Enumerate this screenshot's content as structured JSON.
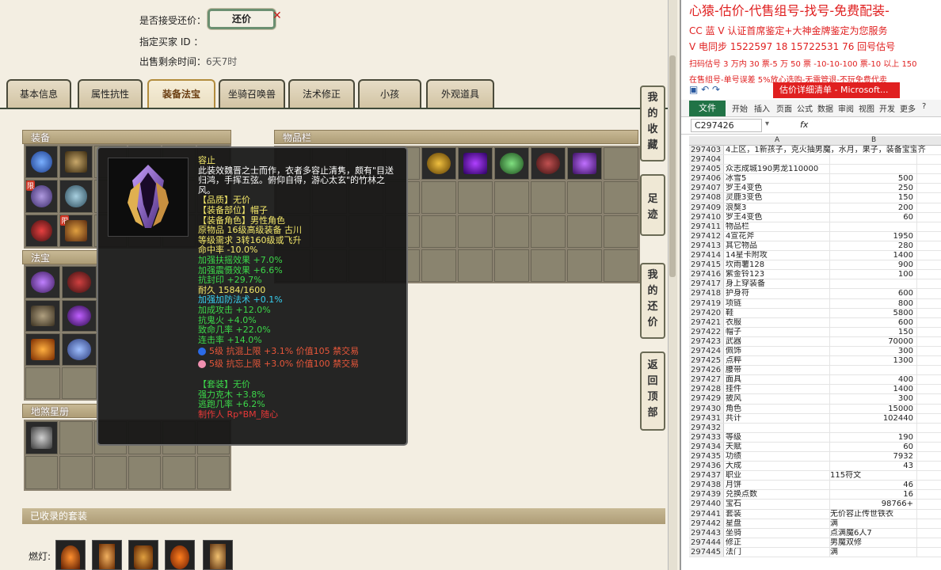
{
  "header": {
    "accept_offer_label": "是否接受还价：",
    "offer_button": "还价",
    "buyer_label": "指定买家 ID ：",
    "time_label": "出售剩余时间：",
    "time_value": "6天7时"
  },
  "tabs": [
    "基本信息",
    "属性抗性",
    "装备法宝",
    "坐骑召唤兽",
    "法术修正",
    "小孩",
    "外观道具"
  ],
  "panels": {
    "equip": "装备",
    "inventory": "物品栏",
    "treasure": "法宝",
    "star_book": "地煞星册",
    "collected_sets": "已收录的套装",
    "lamp_label": "燃灯:"
  },
  "limit_badge": "限",
  "side_nav": [
    [
      "我",
      "的",
      "收",
      "藏"
    ],
    [
      "足",
      "迹"
    ],
    [
      "我",
      "的",
      "还",
      "价"
    ],
    [
      "返",
      "回",
      "顶",
      "部"
    ]
  ],
  "tooltip": {
    "lines": [
      {
        "t": "容止",
        "c": "y"
      },
      {
        "t": "此装效魏晋之士而作，衣者多容止清隽，颇有\"目送",
        "c": "w"
      },
      {
        "t": "归鸿，手挥五弦。俯仰自得，游心太玄\"的竹林之",
        "c": "w"
      },
      {
        "t": "风。",
        "c": "w"
      },
      {
        "t": "【品质】无价",
        "c": "y"
      },
      {
        "t": "【装备部位】帽子",
        "c": "y"
      },
      {
        "t": "【装备角色】男性角色",
        "c": "y"
      },
      {
        "t": "原物品 16级高级装备 古川",
        "c": "y"
      },
      {
        "t": "等级需求 3转160级或飞升",
        "c": "y"
      },
      {
        "t": "命中率 -10.0%",
        "c": "y"
      },
      {
        "t": "加强扶摇效果 +7.0%",
        "c": "g"
      },
      {
        "t": "加强震慑效果 +6.6%",
        "c": "g"
      },
      {
        "t": "抗封印 +29.7%",
        "c": "g"
      },
      {
        "t": "耐久 1584/1600",
        "c": "y"
      },
      {
        "t": "加强加防法术 +0.1%",
        "c": "c"
      },
      {
        "t": "加成攻击 +12.0%",
        "c": "g"
      },
      {
        "t": "抗鬼火 +4.0%",
        "c": "g"
      },
      {
        "t": "致命几率 +22.0%",
        "c": "g"
      },
      {
        "t": "连击率 +14.0%",
        "c": "g"
      }
    ],
    "gems": [
      {
        "t": "5级 抗混上限 +3.1% 价值105 禁交易",
        "color": "#2b6be8"
      },
      {
        "t": "5级 抗忘上限 +3.0% 价值100 禁交易",
        "color": "#f090b0"
      }
    ],
    "set_lines": [
      {
        "t": "【套装】无价",
        "c": "g",
        "tail": "无价",
        "tail_c": "c"
      },
      {
        "t": "强力克木 +3.8%",
        "c": "g"
      },
      {
        "t": "逃跑几率 +6.2%",
        "c": "g"
      },
      {
        "t": "制作人 Rp*BM_随心",
        "c": "r"
      }
    ]
  },
  "ads": [
    {
      "t": "心猿-估价-代售组号-找号-免费配装-",
      "size": 16
    },
    {
      "t": "CC 蓝 V 认证首席鉴定+大神金牌鉴定为您服务",
      "size": 12
    },
    {
      "t": "V 电同步 1522597 18 15722531 76 回号估号",
      "size": 12
    },
    {
      "t": "扫码估号 3 万内 30 票-5 万 50 票 -10-10-100 票-10 以上 150",
      "size": 10
    },
    {
      "t": "在售组号-单号误差 5%放心选购-无需管退-不玩免费代卖",
      "size": 10
    }
  ],
  "excel": {
    "window_title": "估价详细清单 - Microsoft...",
    "file_tab": "文件",
    "menus": [
      "开始",
      "插入",
      "页面",
      "公式",
      "数据",
      "审阅",
      "视图",
      "开发",
      "更多"
    ],
    "name_box": "C297426",
    "fx": "fx",
    "columns": [
      "A",
      "B"
    ],
    "rows": [
      [
        "297403",
        "4上区，1新孩子，克火抽男魔，水月，果子，装备宝宝齐",
        ""
      ],
      [
        "297404",
        "",
        ""
      ],
      [
        "297405",
        "众志成城190男龙110000",
        ""
      ],
      [
        "297406",
        "冰雪5",
        "500"
      ],
      [
        "297407",
        "罗王4变色",
        "250"
      ],
      [
        "297408",
        "灵鹿3变色",
        "150"
      ],
      [
        "297409",
        "浪獒3",
        "200"
      ],
      [
        "297410",
        "罗王4变色",
        "60"
      ],
      [
        "297411",
        "物品栏",
        ""
      ],
      [
        "297412",
        "4宣花斧",
        "1950"
      ],
      [
        "297413",
        "其它物品",
        "280"
      ],
      [
        "297414",
        "14星卡附攻",
        "1400"
      ],
      [
        "297415",
        "坎雨薯128",
        "900"
      ],
      [
        "297416",
        "紫金铃123",
        "100"
      ],
      [
        "297417",
        "身上穿装备",
        ""
      ],
      [
        "297418",
        "护身符",
        "600"
      ],
      [
        "297419",
        "项链",
        "800"
      ],
      [
        "297420",
        "鞋",
        "5800"
      ],
      [
        "297421",
        "衣服",
        "600"
      ],
      [
        "297422",
        "帽子",
        "150"
      ],
      [
        "297423",
        "武器",
        "70000"
      ],
      [
        "297424",
        "佩饰",
        "300"
      ],
      [
        "297425",
        "点粹",
        "1300"
      ],
      [
        "297426",
        "腰带",
        ""
      ],
      [
        "297427",
        "面具",
        "400"
      ],
      [
        "297428",
        "挂件",
        "1400"
      ],
      [
        "297429",
        "披风",
        "300"
      ],
      [
        "297430",
        "角色",
        "15000"
      ],
      [
        "297431",
        "共计",
        "102440"
      ],
      [
        "297432",
        "",
        ""
      ],
      [
        "297433",
        "等级",
        "190"
      ],
      [
        "297434",
        "天赋",
        "60"
      ],
      [
        "297435",
        "功绩",
        "7932"
      ],
      [
        "297436",
        "大成",
        "43"
      ],
      [
        "297437",
        "职业",
        "115符文"
      ],
      [
        "297438",
        "月饼",
        "46"
      ],
      [
        "297439",
        "兑换点数",
        "16"
      ],
      [
        "297440",
        "宝石",
        "98766+"
      ],
      [
        "297441",
        "套装",
        "无价容止传世铁衣"
      ],
      [
        "297442",
        "星盘",
        "满"
      ],
      [
        "297443",
        "坐骑",
        "点满魔6人7"
      ],
      [
        "297444",
        "修正",
        "男魔双修"
      ],
      [
        "297445",
        "法门",
        "满"
      ]
    ]
  },
  "colors": {
    "tab_active": "#b28c3d",
    "ad_red": "#e02020",
    "excel_green": "#217346"
  }
}
